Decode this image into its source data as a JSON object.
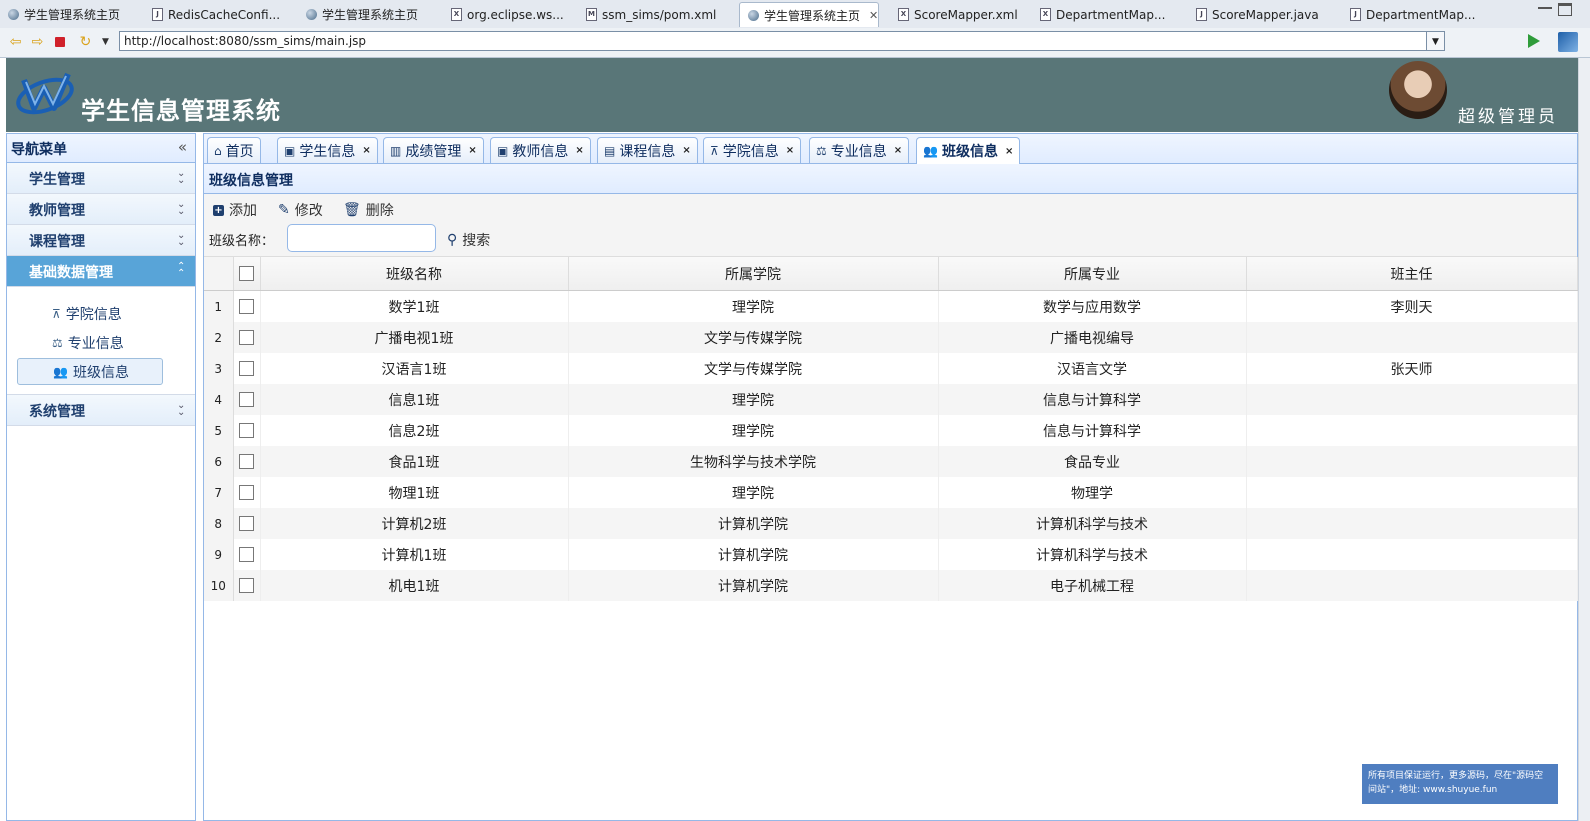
{
  "editor_tabs": [
    {
      "label": "学生管理系统主页",
      "icon": "globe-icon",
      "active": false
    },
    {
      "label": "RedisCacheConfi...",
      "icon": "java-file-icon",
      "active": false
    },
    {
      "label": "学生管理系统主页",
      "icon": "globe-icon",
      "active": false
    },
    {
      "label": "org.eclipse.ws...",
      "icon": "xml-file-icon",
      "active": false
    },
    {
      "label": "ssm_sims/pom.xml",
      "icon": "maven-file-icon",
      "active": false
    },
    {
      "label": "学生管理系统主页",
      "icon": "globe-icon",
      "active": true
    },
    {
      "label": "ScoreMapper.xml",
      "icon": "xml-file-icon",
      "active": false
    },
    {
      "label": "DepartmentMap...",
      "icon": "xml-file-icon",
      "active": false
    },
    {
      "label": "ScoreMapper.java",
      "icon": "java-file-icon",
      "active": false
    },
    {
      "label": "DepartmentMap...",
      "icon": "java-file-icon",
      "active": false
    }
  ],
  "address": {
    "url": "http://localhost:8080/ssm_sims/main.jsp"
  },
  "header": {
    "title": "学生信息管理系统",
    "user_role": "超级管理员"
  },
  "sidebar": {
    "title": "导航菜单",
    "groups": [
      {
        "label": "学生管理"
      },
      {
        "label": "教师管理"
      },
      {
        "label": "课程管理"
      },
      {
        "label": "基础数据管理",
        "expanded": true,
        "items": [
          {
            "label": "学院信息",
            "icon": "sitemap-icon"
          },
          {
            "label": "专业信息",
            "icon": "balance-icon"
          },
          {
            "label": "班级信息",
            "icon": "users-icon"
          }
        ]
      },
      {
        "label": "系统管理"
      }
    ]
  },
  "main_tabs": [
    {
      "label": "首页",
      "icon": "home-icon",
      "closable": false
    },
    {
      "label": "学生信息",
      "icon": "id-card-icon",
      "closable": true
    },
    {
      "label": "成绩管理",
      "icon": "bar-chart-icon",
      "closable": true
    },
    {
      "label": "教师信息",
      "icon": "id-card-icon",
      "closable": true
    },
    {
      "label": "课程信息",
      "icon": "calendar-icon",
      "closable": true
    },
    {
      "label": "学院信息",
      "icon": "sitemap-icon",
      "closable": true
    },
    {
      "label": "专业信息",
      "icon": "balance-icon",
      "closable": true
    },
    {
      "label": "班级信息",
      "icon": "users-icon",
      "closable": true,
      "active": true
    }
  ],
  "panel": {
    "title": "班级信息管理"
  },
  "toolbar": {
    "add": "添加",
    "edit": "修改",
    "delete": "删除",
    "search_label": "班级名称：",
    "search_button": "搜索",
    "search_value": ""
  },
  "table": {
    "columns": [
      "班级名称",
      "所属学院",
      "所属专业",
      "班主任"
    ],
    "rows": [
      [
        "1",
        "数学1班",
        "理学院",
        "数学与应用数学",
        "李则天"
      ],
      [
        "2",
        "广播电视1班",
        "文学与传媒学院",
        "广播电视编导",
        ""
      ],
      [
        "3",
        "汉语言1班",
        "文学与传媒学院",
        "汉语言文学",
        "张天师"
      ],
      [
        "4",
        "信息1班",
        "理学院",
        "信息与计算科学",
        ""
      ],
      [
        "5",
        "信息2班",
        "理学院",
        "信息与计算科学",
        ""
      ],
      [
        "6",
        "食品1班",
        "生物科学与技术学院",
        "食品专业",
        ""
      ],
      [
        "7",
        "物理1班",
        "理学院",
        "物理学",
        ""
      ],
      [
        "8",
        "计算机2班",
        "计算机学院",
        "计算机科学与技术",
        ""
      ],
      [
        "9",
        "计算机1班",
        "计算机学院",
        "计算机科学与技术",
        ""
      ],
      [
        "10",
        "机电1班",
        "计算机学院",
        "电子机械工程",
        ""
      ]
    ]
  },
  "footer_note": "所有项目保证运行，更多源码，尽在\"源码空间站\"，地址: www.shuyue.fun"
}
